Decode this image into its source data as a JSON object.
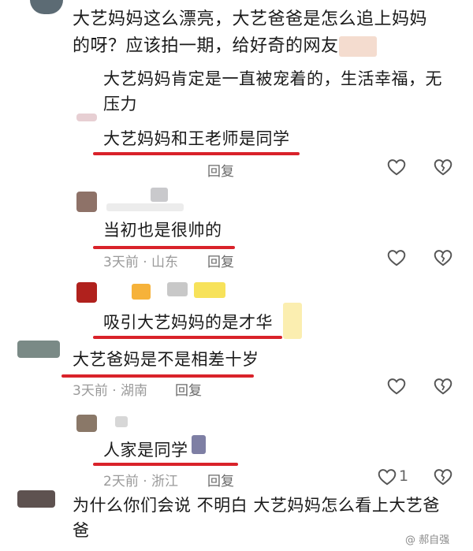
{
  "comments": [
    {
      "text": "大艺妈妈这么漂亮，大艺爸爸是怎么追上妈妈的呀？应该拍一期，给好奇的网友说说"
    },
    {
      "text": "大艺妈妈肯定是一直被宠着的，生活幸福，无压力"
    },
    {
      "text": "大艺妈妈和王老师是同学",
      "meta": "",
      "reply": "回复"
    },
    {
      "text": "当初也是很帅的",
      "meta": "3天前 · 山东",
      "reply": "回复"
    },
    {
      "text": "吸引大艺妈妈的是才华"
    },
    {
      "text": "大艺爸妈是不是相差十岁",
      "meta": "3天前 · 湖南",
      "reply": "回复"
    },
    {
      "text": "人家是同学",
      "meta": "2天前 · 浙江",
      "reply": "回复",
      "likes": "1"
    },
    {
      "text": "为什么你们会说  不明白  大艺妈妈怎么看上大艺爸爸"
    }
  ],
  "watermark": "@ 郝自强",
  "colors": {
    "underline": "#d9222a",
    "text": "#1a1a1a",
    "meta": "#9a9a9a"
  }
}
